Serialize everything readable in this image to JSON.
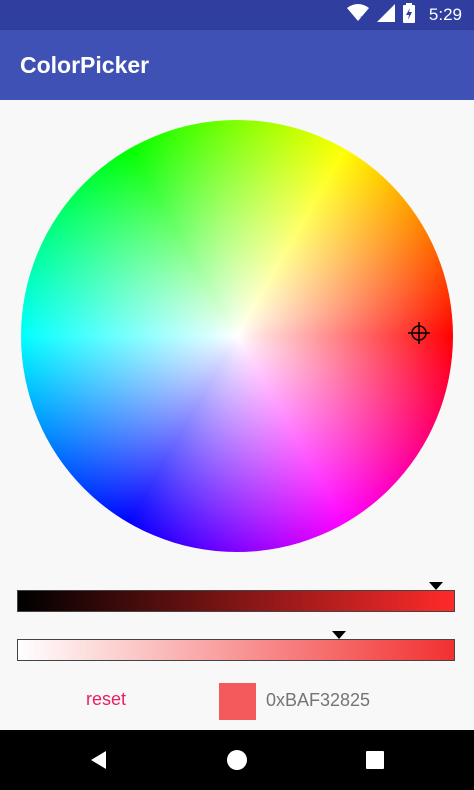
{
  "status_bar": {
    "time": "5:29",
    "icons": [
      "wifi-icon",
      "signal-icon",
      "battery-charging-icon"
    ]
  },
  "app_bar": {
    "title": "ColorPicker"
  },
  "picker": {
    "value_slider": {
      "level": 0.95
    },
    "alpha_slider": {
      "level": 0.73
    },
    "reset_label": "reset",
    "color_hex": "0xBAF32825",
    "swatch_color": "#f25a5c"
  },
  "colors": {
    "status_bar": "#303f9f",
    "app_bar": "#3f51b5",
    "accent": "#e91e63"
  },
  "nav_bar": {
    "icons": [
      "back-icon",
      "home-icon",
      "recents-icon"
    ]
  }
}
